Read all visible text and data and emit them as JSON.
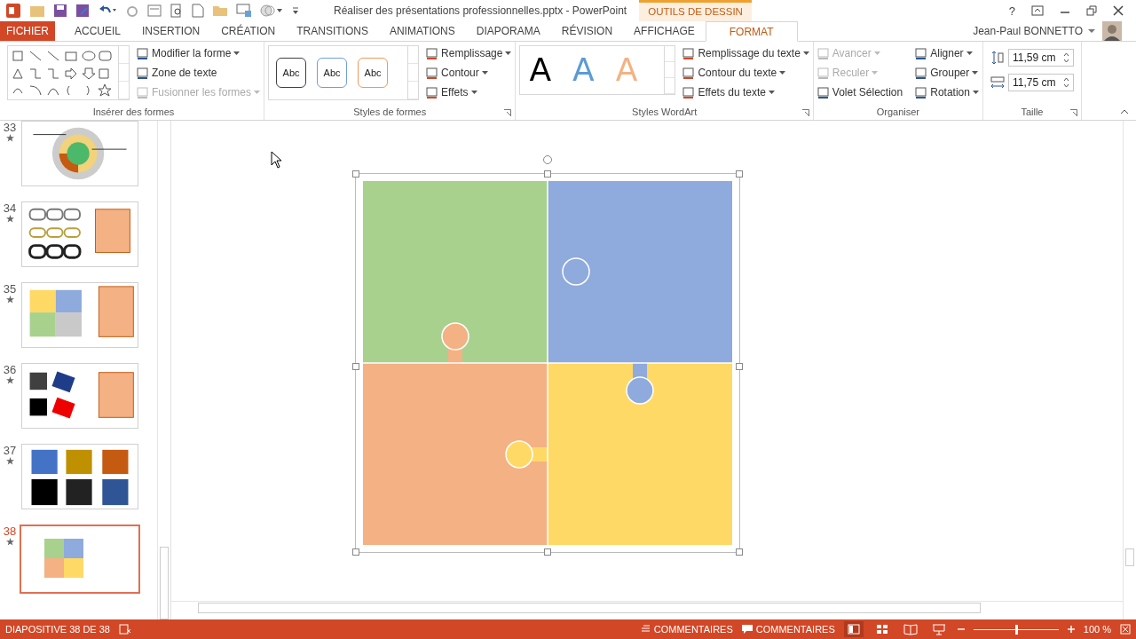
{
  "window": {
    "title": "Réaliser des présentations professionnelles.pptx - PowerPoint",
    "help": "?",
    "context_label": "OUTILS DE DESSIN",
    "user": "Jean-Paul BONNETTO"
  },
  "tabs": [
    {
      "label": "FICHIER",
      "kind": "file",
      "selected": false
    },
    {
      "label": "ACCUEIL",
      "kind": "tab",
      "selected": false
    },
    {
      "label": "INSERTION",
      "kind": "tab",
      "selected": false
    },
    {
      "label": "CRÉATION",
      "kind": "tab",
      "selected": false
    },
    {
      "label": "TRANSITIONS",
      "kind": "tab",
      "selected": false
    },
    {
      "label": "ANIMATIONS",
      "kind": "tab",
      "selected": false
    },
    {
      "label": "DIAPORAMA",
      "kind": "tab",
      "selected": false
    },
    {
      "label": "RÉVISION",
      "kind": "tab",
      "selected": false
    },
    {
      "label": "AFFICHAGE",
      "kind": "tab",
      "selected": false
    },
    {
      "label": "FORMAT",
      "kind": "context",
      "selected": true
    }
  ],
  "ribbon": {
    "groups": [
      {
        "label": "Insérer des formes",
        "kind": "shapes",
        "launcher": false,
        "commands": [
          {
            "label": "Modifier la forme",
            "dropdown": true,
            "disabled": false
          },
          {
            "label": "Zone de texte",
            "dropdown": false,
            "disabled": false
          },
          {
            "label": "Fusionner les formes",
            "dropdown": true,
            "disabled": true
          }
        ]
      },
      {
        "label": "Styles de formes",
        "kind": "styles",
        "launcher": true,
        "gallery": [
          {
            "label": "Abc",
            "color": "#404040"
          },
          {
            "label": "Abc",
            "color": "#6f9fd8"
          },
          {
            "label": "Abc",
            "color": "#ed9a5c"
          }
        ],
        "commands": [
          {
            "label": "Remplissage",
            "dropdown": true,
            "disabled": false
          },
          {
            "label": "Contour",
            "dropdown": true,
            "disabled": false
          },
          {
            "label": "Effets",
            "dropdown": true,
            "disabled": false
          }
        ]
      },
      {
        "label": "Styles WordArt",
        "kind": "wordart",
        "launcher": true,
        "gallery": [
          {
            "label": "A",
            "color": "#000000"
          },
          {
            "label": "A",
            "color": "#5b9bd5"
          },
          {
            "label": "A",
            "color": "#f4b183"
          }
        ],
        "commands": [
          {
            "label": "Remplissage du texte",
            "dropdown": true,
            "disabled": false
          },
          {
            "label": "Contour du texte",
            "dropdown": true,
            "disabled": false
          },
          {
            "label": "Effets du texte",
            "dropdown": true,
            "disabled": false
          }
        ]
      },
      {
        "label": "Organiser",
        "kind": "arrange",
        "launcher": false,
        "commands": [
          {
            "label": "Avancer",
            "dropdown": true,
            "disabled": true
          },
          {
            "label": "Reculer",
            "dropdown": true,
            "disabled": true
          },
          {
            "label": "Volet Sélection",
            "dropdown": false,
            "disabled": false
          },
          {
            "label": "Aligner",
            "dropdown": true,
            "disabled": false
          },
          {
            "label": "Grouper",
            "dropdown": true,
            "disabled": false
          },
          {
            "label": "Rotation",
            "dropdown": true,
            "disabled": false
          }
        ]
      },
      {
        "label": "Taille",
        "kind": "size",
        "launcher": true,
        "fields": [
          {
            "value": "11,59 cm"
          },
          {
            "value": "11,75 cm"
          }
        ]
      }
    ]
  },
  "slides": [
    {
      "number": "33",
      "kind": "cycle",
      "selected": false
    },
    {
      "number": "34",
      "kind": "chains",
      "selected": false
    },
    {
      "number": "35",
      "kind": "puzzle",
      "selected": false
    },
    {
      "number": "36",
      "kind": "padlocks",
      "selected": false
    },
    {
      "number": "37",
      "kind": "columns",
      "selected": false
    },
    {
      "number": "38",
      "kind": "puzzle-small",
      "selected": true
    }
  ],
  "status_bar": {
    "slide_info": "DIAPOSITIVE 38 DE 38",
    "notes": "COMMENTAIRES",
    "comments": "COMMENTAIRES",
    "zoom": "100 %",
    "zoom_slider": {
      "level": 0.5
    }
  }
}
